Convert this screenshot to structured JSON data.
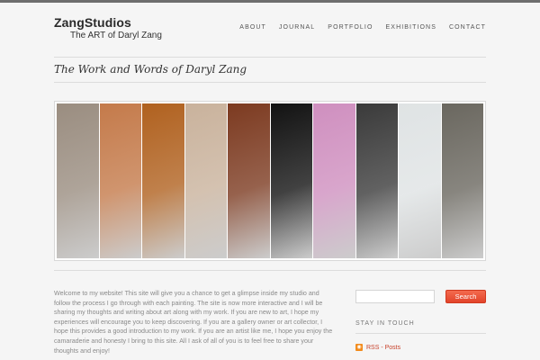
{
  "header": {
    "logo_title": "ZangStudios",
    "logo_subtitle": "The ART of Daryl Zang",
    "nav": [
      {
        "label": "ABOUT"
      },
      {
        "label": "JOURNAL"
      },
      {
        "label": "PORTFOLIO"
      },
      {
        "label": "EXHIBITIONS"
      },
      {
        "label": "CONTACT"
      }
    ]
  },
  "main": {
    "heading": "The Work and Words of Daryl Zang",
    "banner_strip_colors": [
      "#9a8d80",
      "#c47a4a",
      "#b0611f",
      "#c9b29c",
      "#7c3a20",
      "#121212",
      "#cf8fbf",
      "#3a3a3a",
      "#dfe3e4",
      "#6a675f"
    ],
    "intro": "Welcome to my  website!  This site will give you a chance to get a glimpse inside my studio and follow the process I go through with each painting.  The site is now more interactive and I will be sharing my thoughts and writing about art along with my work.  If you are new to art, I hope my experiences will encourage you to keep discovering.  If you are a gallery owner or art collector, I hope this provides a good introduction to my work.  If you are an artist like me, I hope you enjoy the camaraderie and honesty I bring to this site.  All I ask of all of you is to feel free to share your thoughts and enjoy!"
  },
  "sidebar": {
    "search_button": "Search",
    "search_value": "",
    "stay_in_touch": "STAY IN TOUCH",
    "rss_link": "RSS - Posts",
    "rss_icon": "rss-icon"
  },
  "colors": {
    "accent": "#e8492f",
    "topbar": "#6e6e6e",
    "background": "#f5f5f5"
  }
}
